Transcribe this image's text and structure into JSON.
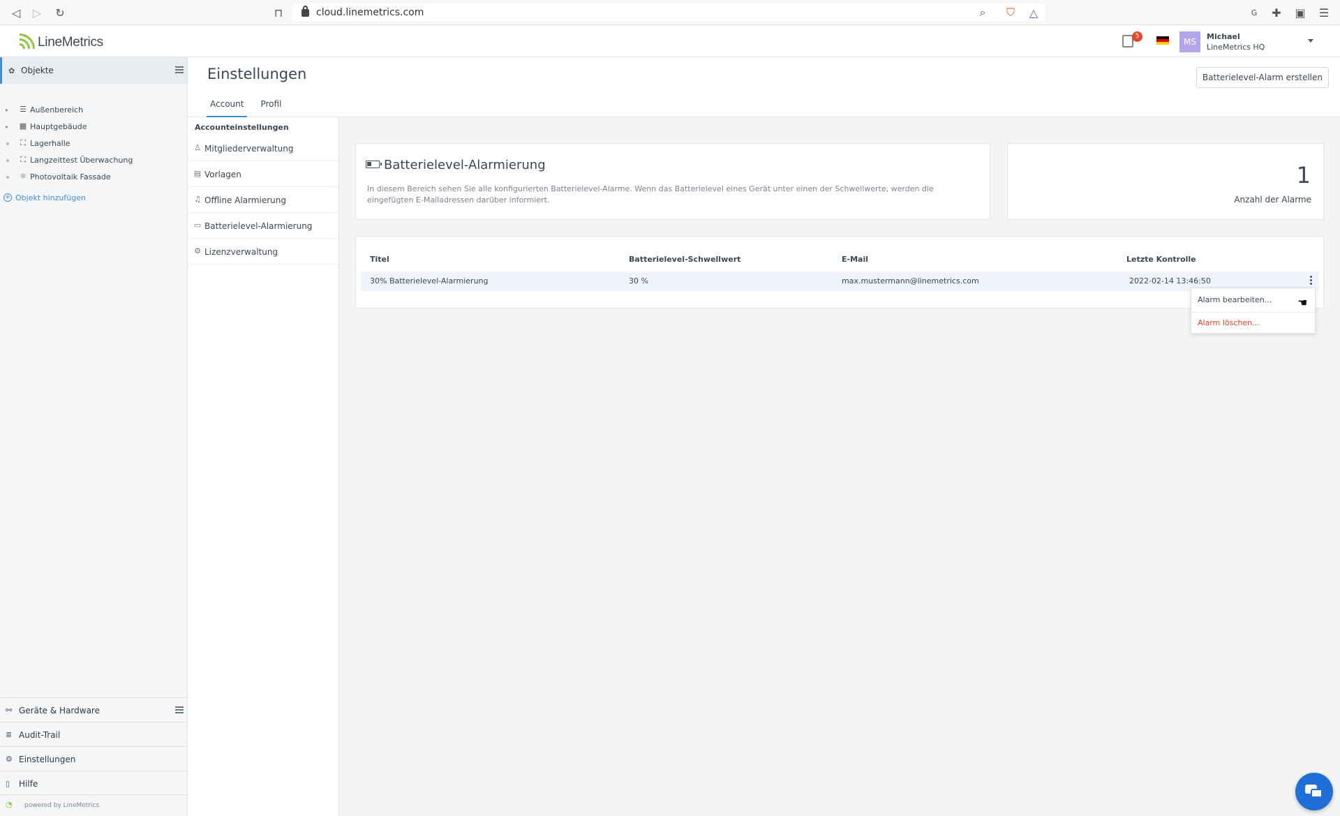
{
  "browser": {
    "url": "cloud.linemetrics.com",
    "icons": [
      "back-icon",
      "forward-icon",
      "reload-icon",
      "bookmark-icon",
      "zoom-icon",
      "brave-shield-icon",
      "brave-rewards-icon",
      "extension-g-icon",
      "puzzle-icon",
      "wallet-icon",
      "menu-icon"
    ]
  },
  "header": {
    "logo_text": "LineMetrics",
    "notification_count": "5",
    "avatar_initials": "MS",
    "user_name": "Michael",
    "user_org": "LineMetrics HQ"
  },
  "sidebar": {
    "title": "Objekte",
    "tree": [
      {
        "label": "Außenbereich",
        "icon": "layers-icon",
        "glyph": "☰",
        "expandable": true
      },
      {
        "label": "Hauptgebäude",
        "icon": "building-icon",
        "glyph": "▦",
        "expandable": true
      },
      {
        "label": "Lagerhalle",
        "icon": "area-icon",
        "glyph": "⛶",
        "expandable": false
      },
      {
        "label": "Langzeittest Überwachung",
        "icon": "area-icon",
        "glyph": "⛶",
        "expandable": false
      },
      {
        "label": "Photovoltaik Fassade",
        "icon": "sun-icon",
        "glyph": "☼",
        "expandable": false
      }
    ],
    "add_object": "Objekt hinzufügen",
    "bottom": [
      {
        "label": "Geräte & Hardware",
        "icon": "devices-icon",
        "glyph": "⚯"
      },
      {
        "label": "Audit-Trail",
        "icon": "list-icon",
        "glyph": "≣"
      },
      {
        "label": "Einstellungen",
        "icon": "gear-icon",
        "glyph": "⚙"
      },
      {
        "label": "Hilfe",
        "icon": "book-icon",
        "glyph": "▯"
      }
    ],
    "powered_by": "powered by LineMetrics"
  },
  "page": {
    "title": "Einstellungen",
    "tabs": [
      "Account",
      "Profil"
    ],
    "active_tab": "Account",
    "create_button": "Batterielevel-Alarm erstellen"
  },
  "subnav": {
    "header": "Accounteinstellungen",
    "items": [
      {
        "label": "Mitgliederverwaltung",
        "icon": "users-icon",
        "glyph": "♙"
      },
      {
        "label": "Vorlagen",
        "icon": "template-icon",
        "glyph": "▤"
      },
      {
        "label": "Offline Alarmierung",
        "icon": "bell-icon",
        "glyph": "♫"
      },
      {
        "label": "Batterielevel-Alarmierung",
        "icon": "battery-icon",
        "glyph": "▭"
      },
      {
        "label": "Lizenzverwaltung",
        "icon": "gear-icon",
        "glyph": "⚙"
      }
    ]
  },
  "info": {
    "title": "Batterielevel-Alarmierung",
    "description": "In diesem Bereich sehen Sie alle konfigurierten Batterielevel-Alarme. Wenn das Batterielevel eines Gerät unter einen der Schwellwerte, werden die eingefügten E-Mailadressen darüber informiert."
  },
  "count": {
    "value": "1",
    "label": "Anzahl der Alarme"
  },
  "table": {
    "columns": [
      "Titel",
      "Batterielevel-Schwellwert",
      "E-Mail",
      "Letzte Kontrolle"
    ],
    "rows": [
      [
        "30% Batterielevel-Alarmierung",
        "30 %",
        "max.mustermann@linemetrics.com",
        "2022-02-14 13:46:50"
      ]
    ]
  },
  "row_menu": {
    "edit": "Alarm bearbeiten...",
    "delete": "Alarm löschen..."
  }
}
